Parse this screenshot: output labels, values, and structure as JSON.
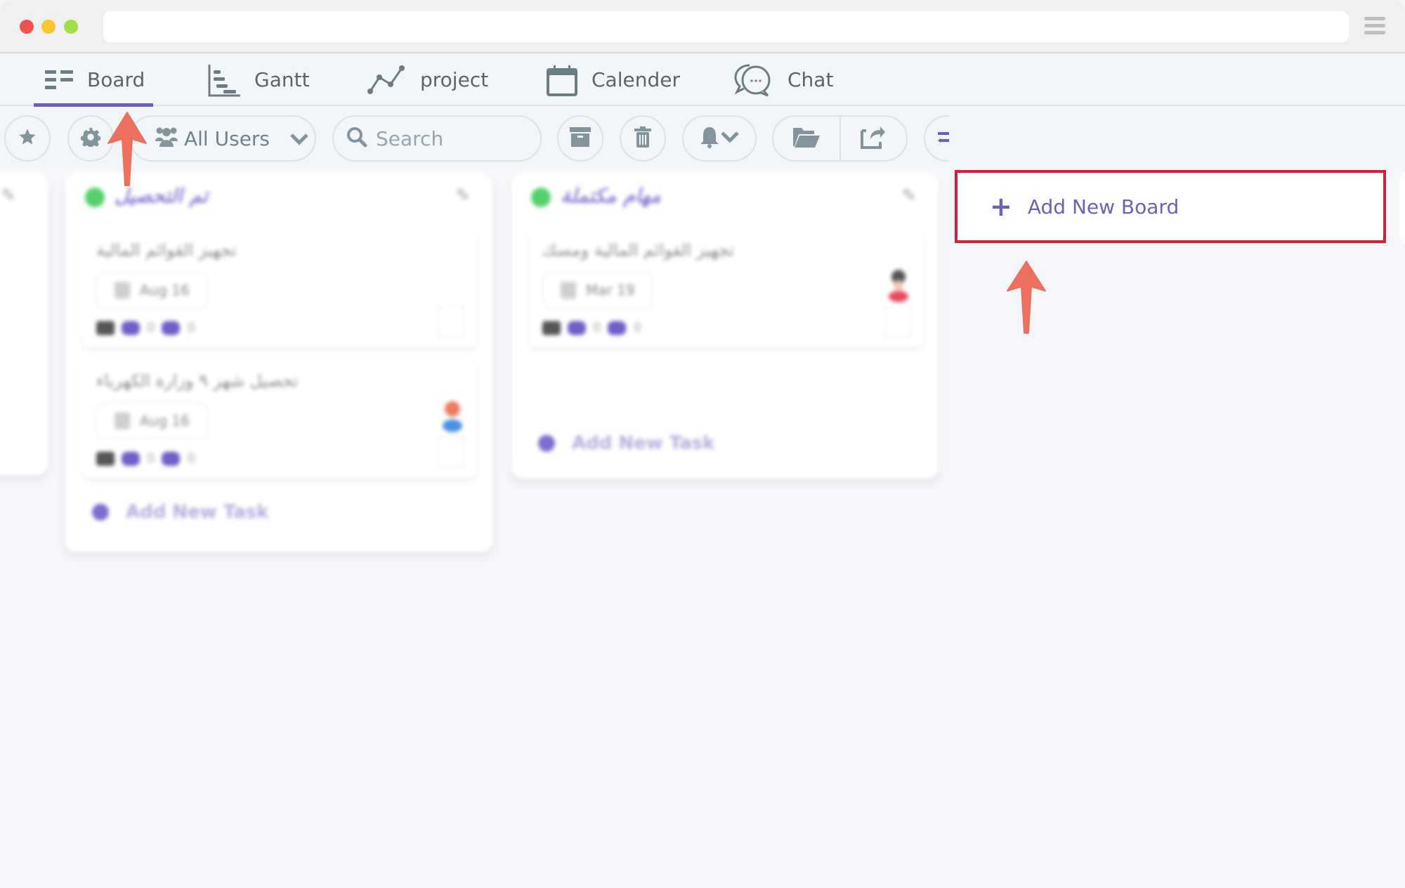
{
  "window": {
    "traffic_lights": [
      "close",
      "minimize",
      "maximize"
    ],
    "url": ""
  },
  "tabs": [
    {
      "label": "Board",
      "icon": "board-icon",
      "active": true
    },
    {
      "label": "Gantt",
      "icon": "gantt-icon",
      "active": false
    },
    {
      "label": "project",
      "icon": "project-line-icon",
      "active": false
    },
    {
      "label": "Calender",
      "icon": "calendar-icon",
      "active": false
    },
    {
      "label": "Chat",
      "icon": "chat-icon",
      "active": false
    }
  ],
  "toolbar": {
    "users_filter": "All Users",
    "search_placeholder": "Search",
    "search_value": ""
  },
  "columns": [
    {
      "title": "تم التحصيل",
      "status_color": "#56d06d",
      "cards": [
        {
          "title": "تجهيز القوائم المالية",
          "date": "Aug 16",
          "attachments": "0",
          "comments": "0",
          "has_avatar": false
        },
        {
          "title": "تحصيل شهر ٩ وزارة الكهرباء",
          "date": "Aug 16",
          "attachments": "0",
          "comments": "0",
          "has_avatar": true
        }
      ],
      "add_task_label": "Add New Task"
    },
    {
      "title": "مهام مكتملة",
      "status_color": "#56d06d",
      "cards": [
        {
          "title": "تجهيز القوائم المالية ومسك",
          "date": "Mar 19",
          "attachments": "0",
          "comments": "0",
          "has_avatar": true
        }
      ],
      "add_task_label": "Add New Task"
    }
  ],
  "add_board": {
    "label": "Add New Board",
    "highlight_color": "#d2203a"
  },
  "colors": {
    "accent": "#6f5fb8",
    "annotation_arrow": "#ec705e",
    "status_green": "#56d06d"
  }
}
